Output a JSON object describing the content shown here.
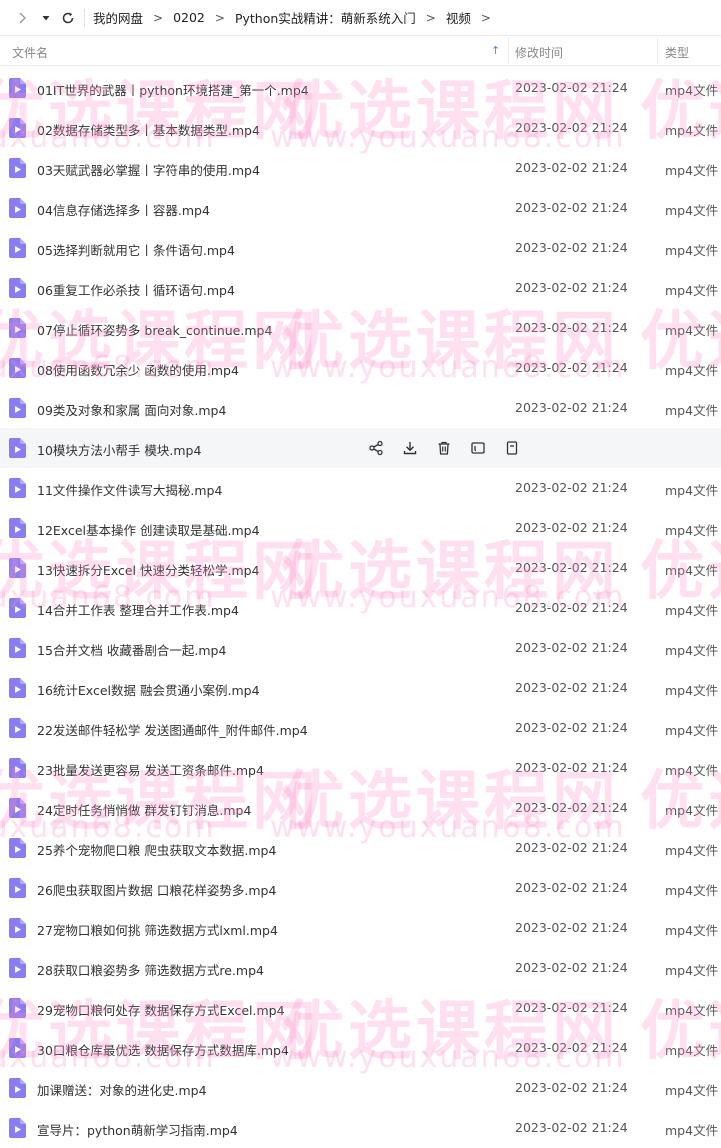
{
  "breadcrumb": [
    "我的网盘",
    "0202",
    "Python实战精讲：萌新系统入门",
    "视频"
  ],
  "breadcrumb_separator": ">",
  "columns": {
    "name": "文件名",
    "modified": "修改时间",
    "type": "类型"
  },
  "files": [
    {
      "name": "01IT世界的武器丨python环境搭建_第一个.mp4",
      "modified": "2023-02-02 21:24",
      "type": "mp4文件"
    },
    {
      "name": "02数据存储类型多丨基本数据类型.mp4",
      "modified": "2023-02-02 21:24",
      "type": "mp4文件"
    },
    {
      "name": "03天赋武器必掌握丨字符串的使用.mp4",
      "modified": "2023-02-02 21:24",
      "type": "mp4文件"
    },
    {
      "name": "04信息存储选择多丨容器.mp4",
      "modified": "2023-02-02 21:24",
      "type": "mp4文件"
    },
    {
      "name": "05选择判断就用它丨条件语句.mp4",
      "modified": "2023-02-02 21:24",
      "type": "mp4文件"
    },
    {
      "name": "06重复工作必杀技丨循环语句.mp4",
      "modified": "2023-02-02 21:24",
      "type": "mp4文件"
    },
    {
      "name": "07停止循环姿势多 break_continue.mp4",
      "modified": "2023-02-02 21:24",
      "type": "mp4文件"
    },
    {
      "name": "08使用函数冗余少 函数的使用.mp4",
      "modified": "2023-02-02 21:24",
      "type": "mp4文件"
    },
    {
      "name": "09类及对象和家属 面向对象.mp4",
      "modified": "2023-02-02 21:24",
      "type": "mp4文件"
    },
    {
      "name": "10模块方法小帮手 模块.mp4",
      "modified": "",
      "type": ""
    },
    {
      "name": "11文件操作文件读写大揭秘.mp4",
      "modified": "2023-02-02 21:24",
      "type": "mp4文件"
    },
    {
      "name": "12Excel基本操作 创建读取是基础.mp4",
      "modified": "2023-02-02 21:24",
      "type": "mp4文件"
    },
    {
      "name": "13快速拆分Excel 快速分类轻松学.mp4",
      "modified": "2023-02-02 21:24",
      "type": "mp4文件"
    },
    {
      "name": "14合并工作表 整理合并工作表.mp4",
      "modified": "2023-02-02 21:24",
      "type": "mp4文件"
    },
    {
      "name": "15合并文档 收藏番剧合一起.mp4",
      "modified": "2023-02-02 21:24",
      "type": "mp4文件"
    },
    {
      "name": "16统计Excel数据 融会贯通小案例.mp4",
      "modified": "2023-02-02 21:24",
      "type": "mp4文件"
    },
    {
      "name": "22发送邮件轻松学 发送图通邮件_附件邮件.mp4",
      "modified": "2023-02-02 21:24",
      "type": "mp4文件"
    },
    {
      "name": "23批量发送更容易 发送工资条邮件.mp4",
      "modified": "2023-02-02 21:24",
      "type": "mp4文件"
    },
    {
      "name": "24定时任务悄悄做 群发钉钉消息.mp4",
      "modified": "2023-02-02 21:24",
      "type": "mp4文件"
    },
    {
      "name": "25养个宠物爬口粮 爬虫获取文本数据.mp4",
      "modified": "2023-02-02 21:24",
      "type": "mp4文件"
    },
    {
      "name": "26爬虫获取图片数据 口粮花样姿势多.mp4",
      "modified": "2023-02-02 21:24",
      "type": "mp4文件"
    },
    {
      "name": "27宠物口粮如何挑 筛选数据方式lxml.mp4",
      "modified": "2023-02-02 21:24",
      "type": "mp4文件"
    },
    {
      "name": "28获取口粮姿势多 筛选数据方式re.mp4",
      "modified": "2023-02-02 21:24",
      "type": "mp4文件"
    },
    {
      "name": "29宠物口粮何处存 数据保存方式Excel.mp4",
      "modified": "2023-02-02 21:24",
      "type": "mp4文件"
    },
    {
      "name": "30口粮仓库最优选 数据保存方式数据库.mp4",
      "modified": "2023-02-02 21:24",
      "type": "mp4文件"
    },
    {
      "name": "加课赠送：对象的进化史.mp4",
      "modified": "2023-02-02 21:24",
      "type": "mp4文件"
    },
    {
      "name": "宣导片：python萌新学习指南.mp4",
      "modified": "2023-02-02 21:24",
      "type": "mp4文件"
    }
  ],
  "hover_row_index": 9,
  "hover_actions": [
    "share-icon",
    "download-icon",
    "delete-icon",
    "rename-icon",
    "more-icon"
  ],
  "watermark": {
    "cn": "优选课程网",
    "url": "www.youxuan68.com"
  },
  "colors": {
    "accent": "#3b8cf3",
    "file_icon": "#8a7cf5",
    "hover_bg": "#f5f6f8",
    "watermark": "#ff8cc8"
  }
}
